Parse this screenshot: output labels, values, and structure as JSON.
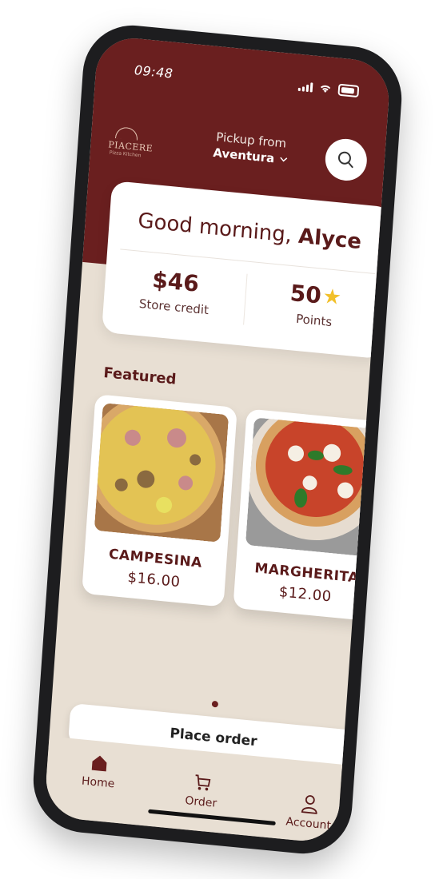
{
  "status_bar": {
    "time": "09:48"
  },
  "brand": {
    "logo_text": "PIACERE",
    "logo_sub": "Pizza Kitchen"
  },
  "pickup": {
    "label": "Pickup from",
    "location": "Aventura"
  },
  "welcome": {
    "greeting_prefix": "Good morning,",
    "name": "Alyce",
    "credit_value": "$46",
    "credit_label": "Store credit",
    "points_value": "50",
    "points_label": "Points"
  },
  "featured": {
    "title": "Featured",
    "items": [
      {
        "name": "CAMPESINA",
        "price": "$16.00"
      },
      {
        "name": "MARGHERITA",
        "price": "$12.00"
      }
    ]
  },
  "cta": {
    "place_order": "Place order"
  },
  "tabs": [
    {
      "label": "Home",
      "icon": "home-icon"
    },
    {
      "label": "Order",
      "icon": "cart-icon"
    },
    {
      "label": "Account",
      "icon": "user-icon"
    }
  ],
  "colors": {
    "primary": "#6a1f1f",
    "background": "#e8dfd3",
    "star": "#f2c02a"
  }
}
